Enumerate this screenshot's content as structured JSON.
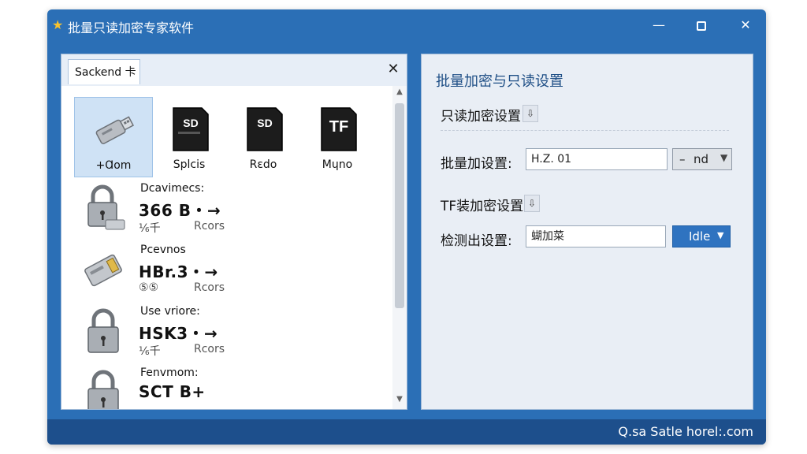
{
  "window": {
    "title": "批量只读加密专家软件",
    "icon": "star-icon"
  },
  "left_panel": {
    "tab_label": "Sackend 卡",
    "devices": [
      {
        "label": "+Ɑom",
        "icon": "usb-drive-icon",
        "selected": true
      },
      {
        "label": "Splcis",
        "icon": "sd-card-icon",
        "selected": false
      },
      {
        "label": "Rɛdo",
        "icon": "sd-card-icon",
        "selected": false
      },
      {
        "label": "Mɥno",
        "icon": "tf-card-icon",
        "selected": false
      }
    ],
    "tf_badge": "TF",
    "sd_badge": "SD",
    "items": [
      {
        "title": "Dcavimecs:",
        "value": "366 B・→",
        "meta1": "⅙千",
        "meta2": "Rcors",
        "icon": "padlock-usb-icon"
      },
      {
        "title": "Pcevnos",
        "value": "HBr.3・→",
        "meta1": "⑤⑤",
        "meta2": "Rcors",
        "icon": "memory-card-icon"
      },
      {
        "title": "Use vriore:",
        "value": "HSK3・→",
        "meta1": "⅙千",
        "meta2": "Rcors",
        "icon": "padlock-icon"
      },
      {
        "title": "Fenvmom:",
        "value": "SCT B+",
        "meta1": "",
        "meta2": "",
        "icon": "padlock-icon"
      }
    ]
  },
  "right_panel": {
    "title": "批量加密与只读设置",
    "readonly_section": "只读加密设置",
    "batch_label": "批量加设置:",
    "batch_value": "H.Z. 01",
    "batch_select": "nd",
    "batch_select_prefix": "–",
    "tf_section": "TF装加密设置",
    "detect_label": "检测出设置:",
    "detect_value": "蝴加菜",
    "status_select": "Idle"
  },
  "status_bar": {
    "text": "Q.sa  Satle horel:.com"
  }
}
